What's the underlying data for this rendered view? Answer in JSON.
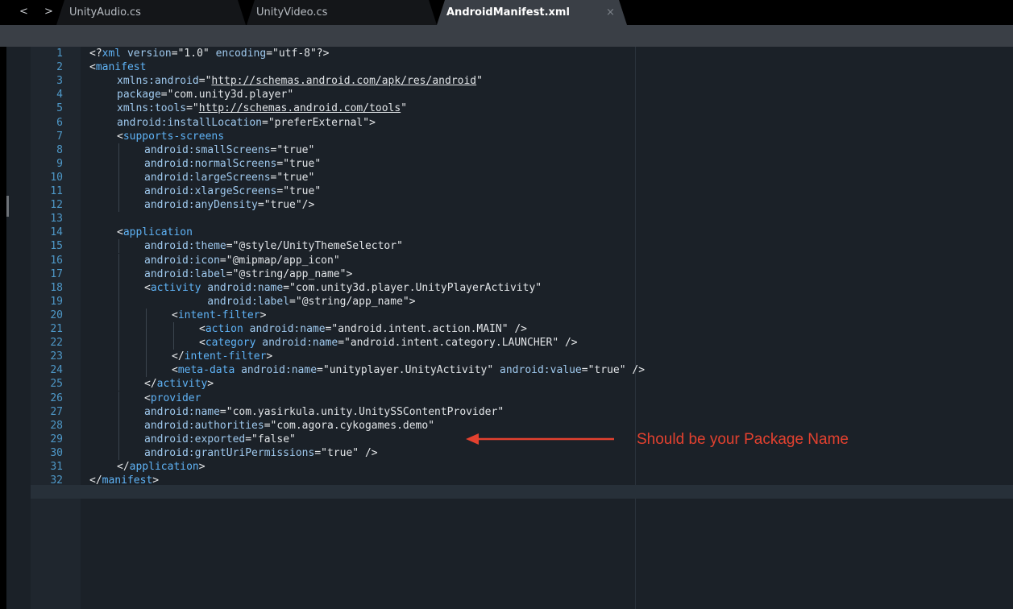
{
  "tabs": [
    {
      "label": "UnityAudio.cs",
      "active": false
    },
    {
      "label": "UnityVideo.cs",
      "active": false
    },
    {
      "label": "AndroidManifest.xml",
      "active": true,
      "close": "×"
    }
  ],
  "nav": {
    "back": "<",
    "forward": ">"
  },
  "annotation": {
    "text": "Should be your Package Name",
    "color": "#e3412f"
  },
  "lines": [
    {
      "n": "1",
      "indent": 0,
      "tokens": [
        [
          "punc",
          "<?"
        ],
        [
          "tag",
          "xml"
        ],
        [
          "str",
          " "
        ],
        [
          "attr",
          "version"
        ],
        [
          "punc",
          "=\""
        ],
        [
          "str",
          "1.0"
        ],
        [
          "punc",
          "\""
        ],
        [
          "str",
          " "
        ],
        [
          "attr",
          "encoding"
        ],
        [
          "punc",
          "=\""
        ],
        [
          "str",
          "utf-8"
        ],
        [
          "punc",
          "\"?>"
        ]
      ]
    },
    {
      "n": "2",
      "indent": 0,
      "tokens": [
        [
          "punc",
          "<"
        ],
        [
          "tag",
          "manifest"
        ]
      ]
    },
    {
      "n": "3",
      "indent": 1,
      "tokens": [
        [
          "attr",
          "xmlns:android"
        ],
        [
          "punc",
          "=\""
        ],
        [
          "url",
          "http://schemas.android.com/apk/res/android"
        ],
        [
          "punc",
          "\""
        ]
      ]
    },
    {
      "n": "4",
      "indent": 1,
      "tokens": [
        [
          "attr",
          "package"
        ],
        [
          "punc",
          "=\""
        ],
        [
          "str",
          "com.unity3d.player"
        ],
        [
          "punc",
          "\""
        ]
      ]
    },
    {
      "n": "5",
      "indent": 1,
      "tokens": [
        [
          "attr",
          "xmlns:tools"
        ],
        [
          "punc",
          "=\""
        ],
        [
          "url",
          "http://schemas.android.com/tools"
        ],
        [
          "punc",
          "\""
        ]
      ]
    },
    {
      "n": "6",
      "indent": 1,
      "tokens": [
        [
          "attr",
          "android:installLocation"
        ],
        [
          "punc",
          "=\""
        ],
        [
          "str",
          "preferExternal"
        ],
        [
          "punc",
          "\">"
        ]
      ]
    },
    {
      "n": "7",
      "indent": 1,
      "tokens": [
        [
          "punc",
          "<"
        ],
        [
          "tag",
          "supports-screens"
        ]
      ]
    },
    {
      "n": "8",
      "indent": 2,
      "tokens": [
        [
          "attr",
          "android:smallScreens"
        ],
        [
          "punc",
          "=\""
        ],
        [
          "str",
          "true"
        ],
        [
          "punc",
          "\""
        ]
      ]
    },
    {
      "n": "9",
      "indent": 2,
      "tokens": [
        [
          "attr",
          "android:normalScreens"
        ],
        [
          "punc",
          "=\""
        ],
        [
          "str",
          "true"
        ],
        [
          "punc",
          "\""
        ]
      ]
    },
    {
      "n": "10",
      "indent": 2,
      "tokens": [
        [
          "attr",
          "android:largeScreens"
        ],
        [
          "punc",
          "=\""
        ],
        [
          "str",
          "true"
        ],
        [
          "punc",
          "\""
        ]
      ]
    },
    {
      "n": "11",
      "indent": 2,
      "tokens": [
        [
          "attr",
          "android:xlargeScreens"
        ],
        [
          "punc",
          "=\""
        ],
        [
          "str",
          "true"
        ],
        [
          "punc",
          "\""
        ]
      ]
    },
    {
      "n": "12",
      "indent": 2,
      "tokens": [
        [
          "attr",
          "android:anyDensity"
        ],
        [
          "punc",
          "=\""
        ],
        [
          "str",
          "true"
        ],
        [
          "punc",
          "\"/>"
        ]
      ]
    },
    {
      "n": "13",
      "indent": 0,
      "tokens": []
    },
    {
      "n": "14",
      "indent": 1,
      "tokens": [
        [
          "punc",
          "<"
        ],
        [
          "tag",
          "application"
        ]
      ]
    },
    {
      "n": "15",
      "indent": 2,
      "tokens": [
        [
          "attr",
          "android:theme"
        ],
        [
          "punc",
          "=\""
        ],
        [
          "str",
          "@style/UnityThemeSelector"
        ],
        [
          "punc",
          "\""
        ]
      ]
    },
    {
      "n": "16",
      "indent": 2,
      "tokens": [
        [
          "attr",
          "android:icon"
        ],
        [
          "punc",
          "=\""
        ],
        [
          "str",
          "@mipmap/app_icon"
        ],
        [
          "punc",
          "\""
        ]
      ]
    },
    {
      "n": "17",
      "indent": 2,
      "tokens": [
        [
          "attr",
          "android:label"
        ],
        [
          "punc",
          "=\""
        ],
        [
          "str",
          "@string/app_name"
        ],
        [
          "punc",
          "\">"
        ]
      ]
    },
    {
      "n": "18",
      "indent": 2,
      "tokens": [
        [
          "punc",
          "<"
        ],
        [
          "tag",
          "activity"
        ],
        [
          "str",
          " "
        ],
        [
          "attr",
          "android:name"
        ],
        [
          "punc",
          "=\""
        ],
        [
          "str",
          "com.unity3d.player.UnityPlayerActivity"
        ],
        [
          "punc",
          "\""
        ]
      ]
    },
    {
      "n": "19",
      "indent": 2,
      "pad": "          ",
      "tokens": [
        [
          "attr",
          "android:label"
        ],
        [
          "punc",
          "=\""
        ],
        [
          "str",
          "@string/app_name"
        ],
        [
          "punc",
          "\">"
        ]
      ]
    },
    {
      "n": "20",
      "indent": 3,
      "tokens": [
        [
          "punc",
          "<"
        ],
        [
          "tag",
          "intent-filter"
        ],
        [
          "punc",
          ">"
        ]
      ]
    },
    {
      "n": "21",
      "indent": 4,
      "tokens": [
        [
          "punc",
          "<"
        ],
        [
          "tag",
          "action"
        ],
        [
          "str",
          " "
        ],
        [
          "attr",
          "android:name"
        ],
        [
          "punc",
          "=\""
        ],
        [
          "str",
          "android.intent.action.MAIN"
        ],
        [
          "punc",
          "\" />"
        ]
      ]
    },
    {
      "n": "22",
      "indent": 4,
      "tokens": [
        [
          "punc",
          "<"
        ],
        [
          "tag",
          "category"
        ],
        [
          "str",
          " "
        ],
        [
          "attr",
          "android:name"
        ],
        [
          "punc",
          "=\""
        ],
        [
          "str",
          "android.intent.category.LAUNCHER"
        ],
        [
          "punc",
          "\" />"
        ]
      ]
    },
    {
      "n": "23",
      "indent": 3,
      "tokens": [
        [
          "punc",
          "</"
        ],
        [
          "tag",
          "intent-filter"
        ],
        [
          "punc",
          ">"
        ]
      ]
    },
    {
      "n": "24",
      "indent": 3,
      "tokens": [
        [
          "punc",
          "<"
        ],
        [
          "tag",
          "meta-data"
        ],
        [
          "str",
          " "
        ],
        [
          "attr",
          "android:name"
        ],
        [
          "punc",
          "=\""
        ],
        [
          "str",
          "unityplayer.UnityActivity"
        ],
        [
          "punc",
          "\""
        ],
        [
          "str",
          " "
        ],
        [
          "attr",
          "android:value"
        ],
        [
          "punc",
          "=\""
        ],
        [
          "str",
          "true"
        ],
        [
          "punc",
          "\" />"
        ]
      ]
    },
    {
      "n": "25",
      "indent": 2,
      "tokens": [
        [
          "punc",
          "</"
        ],
        [
          "tag",
          "activity"
        ],
        [
          "punc",
          ">"
        ]
      ]
    },
    {
      "n": "26",
      "indent": 2,
      "tokens": [
        [
          "punc",
          "<"
        ],
        [
          "tag",
          "provider"
        ]
      ]
    },
    {
      "n": "27",
      "indent": 2,
      "tokens": [
        [
          "attr",
          "android:name"
        ],
        [
          "punc",
          "=\""
        ],
        [
          "str",
          "com.yasirkula.unity.UnitySSContentProvider"
        ],
        [
          "punc",
          "\""
        ]
      ]
    },
    {
      "n": "28",
      "indent": 2,
      "tokens": [
        [
          "attr",
          "android:authorities"
        ],
        [
          "punc",
          "=\""
        ],
        [
          "str",
          "com.agora.cykogames.demo"
        ],
        [
          "punc",
          "\""
        ]
      ]
    },
    {
      "n": "29",
      "indent": 2,
      "tokens": [
        [
          "attr",
          "android:exported"
        ],
        [
          "punc",
          "=\""
        ],
        [
          "str",
          "false"
        ],
        [
          "punc",
          "\""
        ]
      ]
    },
    {
      "n": "30",
      "indent": 2,
      "tokens": [
        [
          "attr",
          "android:grantUriPermissions"
        ],
        [
          "punc",
          "=\""
        ],
        [
          "str",
          "true"
        ],
        [
          "punc",
          "\" />"
        ]
      ]
    },
    {
      "n": "31",
      "indent": 1,
      "tokens": [
        [
          "punc",
          "</"
        ],
        [
          "tag",
          "application"
        ],
        [
          "punc",
          ">"
        ]
      ]
    },
    {
      "n": "32",
      "indent": 0,
      "tokens": [
        [
          "punc",
          "</"
        ],
        [
          "tag",
          "manifest"
        ],
        [
          "punc",
          ">"
        ]
      ]
    }
  ]
}
